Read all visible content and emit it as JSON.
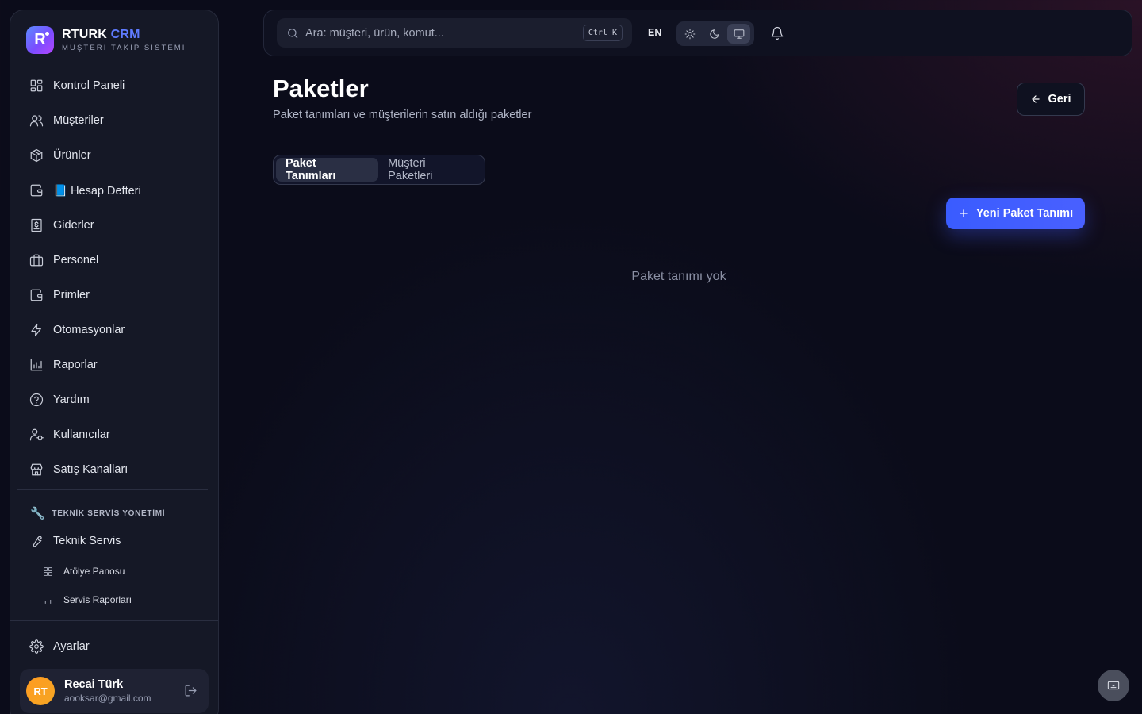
{
  "brand": {
    "logo_letter": "R",
    "name_primary": "RTURK",
    "name_accent": "CRM",
    "subtitle": "MÜŞTERİ TAKİP SİSTEMİ"
  },
  "sidebar": {
    "items": [
      {
        "label": "Kontrol Paneli",
        "icon": "dashboard-icon"
      },
      {
        "label": "Müşteriler",
        "icon": "users-icon"
      },
      {
        "label": "Ürünler",
        "icon": "package-icon"
      },
      {
        "label": "📘 Hesap Defteri",
        "icon": "wallet-icon"
      },
      {
        "label": "Giderler",
        "icon": "receipt-dollar-icon"
      },
      {
        "label": "Personel",
        "icon": "briefcase-icon"
      },
      {
        "label": "Primler",
        "icon": "wallet-icon"
      },
      {
        "label": "Otomasyonlar",
        "icon": "lightning-icon"
      },
      {
        "label": "Raporlar",
        "icon": "bar-chart-icon"
      },
      {
        "label": "Yardım",
        "icon": "help-circle-icon"
      },
      {
        "label": "Kullanıcılar",
        "icon": "user-cog-icon"
      },
      {
        "label": "Satış Kanalları",
        "icon": "store-icon"
      }
    ],
    "section_title": "TEKNİK SERVİS YÖNETİMİ",
    "section_icon": "🔧",
    "service_item": "Teknik Servis",
    "sub_items": [
      {
        "label": "Atölye Panosu",
        "icon": "grid-icon"
      },
      {
        "label": "Servis Raporları",
        "icon": "bar-chart-icon"
      }
    ],
    "settings": "Ayarlar"
  },
  "user": {
    "initials": "RT",
    "name": "Recai Türk",
    "email": "aooksar@gmail.com"
  },
  "topbar": {
    "search_placeholder": "Ara: müşteri, ürün, komut...",
    "shortcut": "Ctrl K",
    "language": "EN",
    "theme_selected": "system"
  },
  "main": {
    "title": "Paketler",
    "subtitle": "Paket tanımları ve müşterilerin satın aldığı paketler",
    "back_label": "Geri",
    "tabs": [
      {
        "label": "Paket Tanımları",
        "active": true
      },
      {
        "label": "Müşteri Paketleri",
        "active": false
      }
    ],
    "new_button": "Yeni Paket Tanımı",
    "empty_text": "Paket tanımı yok"
  },
  "colors": {
    "accent": "#3a5cff",
    "background": "#0b0c1a",
    "sidebar": "#151826",
    "avatar": "#ff9b22"
  }
}
